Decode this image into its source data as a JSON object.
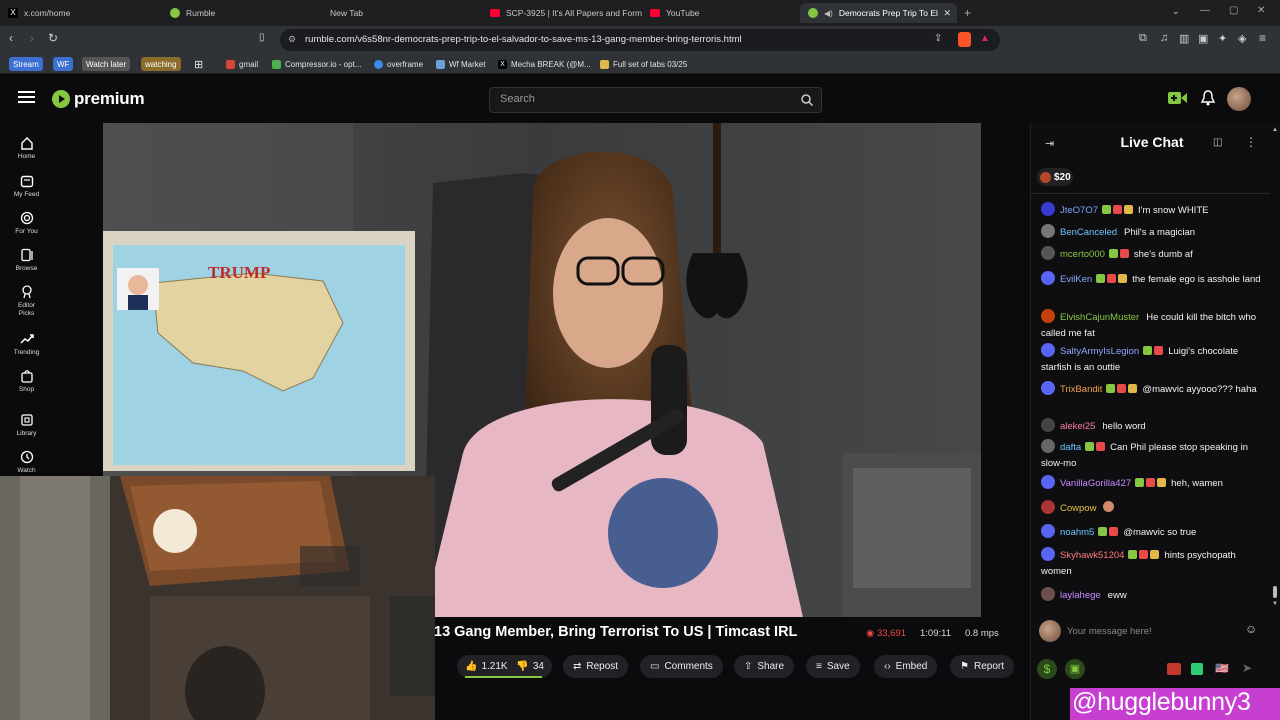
{
  "browser": {
    "tabs": [
      {
        "label": "x.com/home",
        "icon": "x-logo-icon",
        "color": "#000000"
      },
      {
        "label": "Rumble",
        "icon": "rumble-logo-icon",
        "color": "#85c742"
      },
      {
        "label": "New Tab",
        "icon": "",
        "color": ""
      },
      {
        "label": "SCP-3925 | It's All Papers and Form",
        "icon": "youtube-logo-icon",
        "color": "#ff0033"
      },
      {
        "label": "YouTube",
        "icon": "youtube-logo-icon",
        "color": "#ff0033"
      },
      {
        "label": "Democrats Prep Trip To El Sa",
        "icon": "rumble-logo-icon",
        "color": "#85c742"
      }
    ],
    "url": "rumble.com/v6s58nr-democrats-prep-trip-to-el-salvador-to-save-ms-13-gang-member-bring-terroris.html",
    "bookmarks": [
      {
        "label": "Stream",
        "color": "#3b6fd1"
      },
      {
        "label": "WF",
        "color": "#3b6fd1"
      },
      {
        "label": "Watch later",
        "color": "#555555"
      },
      {
        "label": "watching",
        "color": "#8a6d2b"
      },
      {
        "label": "gmail",
        "color": "#d44638"
      },
      {
        "label": "Compressor.io - opt...",
        "color": "#4caf50"
      },
      {
        "label": "overframe",
        "color": "#3a8ee6"
      },
      {
        "label": "Wf Market",
        "color": "#6ba0d8"
      },
      {
        "label": "Mecha BREAK (@M...",
        "color": "#000000"
      },
      {
        "label": "Full set of tabs 03/25",
        "color": "#e0b84a"
      }
    ]
  },
  "site": {
    "logo": "premium",
    "search_placeholder": "Search",
    "nav": [
      {
        "label": "Home",
        "icon": "home-icon"
      },
      {
        "label": "My Feed",
        "icon": "feed-icon"
      },
      {
        "label": "For You",
        "icon": "target-icon"
      },
      {
        "label": "Browse",
        "icon": "browse-icon"
      },
      {
        "label": "Editor Picks",
        "icon": "medal-icon"
      },
      {
        "label": "Trending",
        "icon": "trending-icon"
      },
      {
        "label": "Shop",
        "icon": "shop-icon"
      },
      {
        "label": "Library",
        "icon": "library-icon"
      },
      {
        "label": "Watch",
        "icon": "history-icon"
      }
    ]
  },
  "video": {
    "title": "13 Gang Member, Bring Terrorist To US | Timcast IRL",
    "viewers": "33,691",
    "duration": "1:09:11",
    "bitrate": "0.8 mps",
    "likes": "1.21K",
    "dislikes": "34",
    "like_ratio": 0.97,
    "actions": [
      "Repost",
      "Comments",
      "Share",
      "Save",
      "Embed",
      "Report"
    ],
    "map_title": "TRUMP"
  },
  "chat": {
    "title": "Live Chat",
    "rant_amount": "$20",
    "input_placeholder": "Your message here!",
    "messages": [
      {
        "user": "JteO7O7",
        "text": "I'm snow WHITE",
        "user_color": "#7ba3ff",
        "avatar": "#3a3ad0"
      },
      {
        "user": "BenCanceled",
        "text": "Phil's a magician",
        "user_color": "#6ec6ff",
        "avatar": "#777777"
      },
      {
        "user": "mcerto000",
        "text": "she's dumb af",
        "user_color": "#85c742",
        "avatar": "#555555"
      },
      {
        "user": "EvilKen",
        "text": "the female ego is asshole land",
        "user_color": "#8aa8ff",
        "avatar": "#5865f2"
      },
      {
        "user": "ElvishCajunMuster",
        "text": "He could kill the bitch who called me fat",
        "user_color": "#85c742",
        "avatar": "#c2410c"
      },
      {
        "user": "SaltyArmyIsLegion",
        "text": "Luigi's chocolate starfish is an outtie",
        "user_color": "#8aa8ff",
        "avatar": "#5865f2"
      },
      {
        "user": "TrixBandit",
        "text": "@mawvic ayyooo??? haha",
        "user_color": "#f0a04b",
        "avatar": "#5865f2"
      },
      {
        "user": "alekei25",
        "text": "hello word",
        "user_color": "#ff7aa8",
        "avatar": "#444444"
      },
      {
        "user": "dafta",
        "text": "Can Phil please stop speaking in slow-mo",
        "user_color": "#6ec6ff",
        "avatar": "#666666"
      },
      {
        "user": "VanillaGorilla427",
        "text": "heh, wamen",
        "user_color": "#c58bff",
        "avatar": "#5865f2"
      },
      {
        "user": "Cowpow",
        "text": "",
        "user_color": "#e6c04a",
        "avatar": "#a33"
      },
      {
        "user": "noahm5",
        "text": "@mawvic so true",
        "user_color": "#6ec6ff",
        "avatar": "#5865f2"
      },
      {
        "user": "Skyhawk51204",
        "text": "hints psychopath women",
        "user_color": "#ff7a7a",
        "avatar": "#5865f2"
      },
      {
        "user": "laylahege",
        "text": "eww",
        "user_color": "#c58bff",
        "avatar": "#6b4f4f"
      }
    ]
  },
  "overlay": {
    "handle": "@hugglebunny3",
    "color": "#c63fd1"
  }
}
